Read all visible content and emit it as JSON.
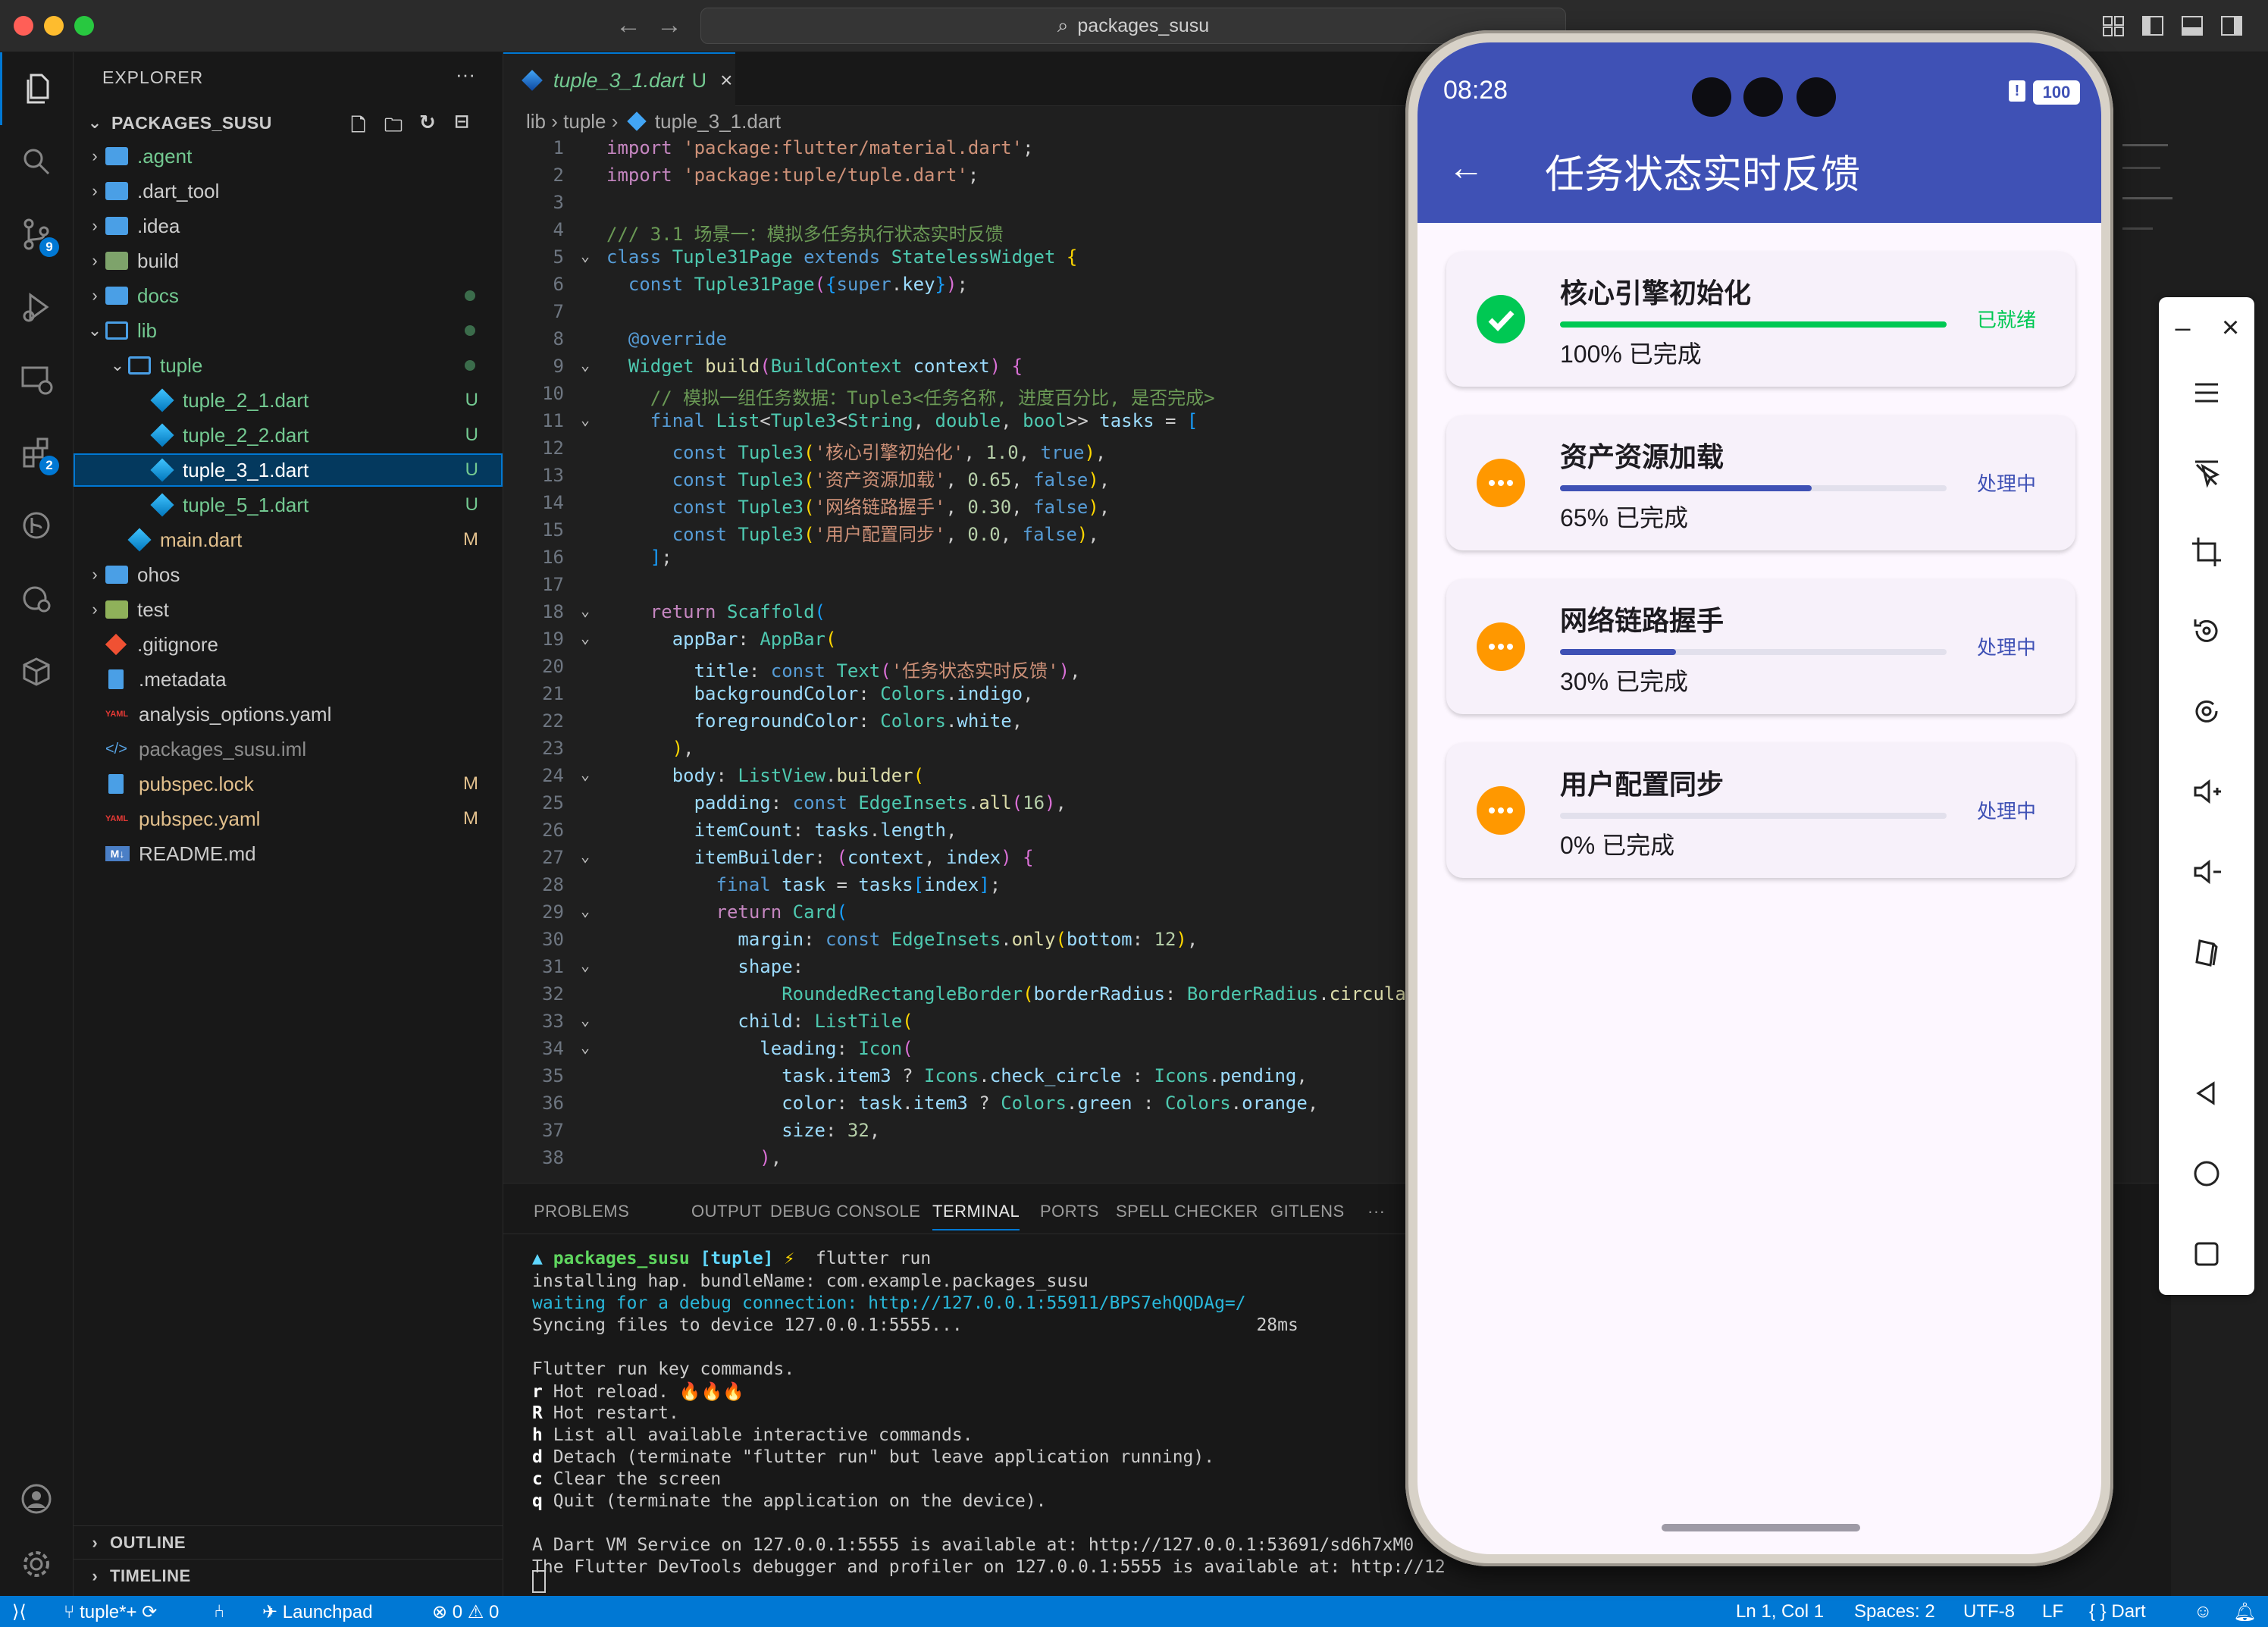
{
  "titlebar": {
    "search": "packages_susu"
  },
  "activity": {
    "scm_badge": "9",
    "extensions_badge": "2"
  },
  "explorer": {
    "title": "EXPLORER",
    "root": "PACKAGES_SUSU",
    "items": [
      {
        "label": ".agent",
        "tag": ""
      },
      {
        "label": ".dart_tool",
        "tag": ""
      },
      {
        "label": ".idea",
        "tag": ""
      },
      {
        "label": "build",
        "tag": ""
      },
      {
        "label": "docs",
        "tag": ""
      },
      {
        "label": "lib",
        "tag": ""
      },
      {
        "label": "tuple",
        "tag": ""
      },
      {
        "label": "tuple_2_1.dart",
        "tag": "U"
      },
      {
        "label": "tuple_2_2.dart",
        "tag": "U"
      },
      {
        "label": "tuple_3_1.dart",
        "tag": "U"
      },
      {
        "label": "tuple_5_1.dart",
        "tag": "U"
      },
      {
        "label": "main.dart",
        "tag": "M"
      },
      {
        "label": "ohos",
        "tag": ""
      },
      {
        "label": "test",
        "tag": ""
      },
      {
        "label": ".gitignore",
        "tag": ""
      },
      {
        "label": ".metadata",
        "tag": ""
      },
      {
        "label": "analysis_options.yaml",
        "tag": ""
      },
      {
        "label": "packages_susu.iml",
        "tag": ""
      },
      {
        "label": "pubspec.lock",
        "tag": "M"
      },
      {
        "label": "pubspec.yaml",
        "tag": "M"
      },
      {
        "label": "README.md",
        "tag": ""
      }
    ],
    "outline": "OUTLINE",
    "timeline": "TIMELINE"
  },
  "editor": {
    "tab": {
      "label": "tuple_3_1.dart",
      "status": "U"
    },
    "breadcrumb": [
      "lib",
      "tuple",
      "tuple_3_1.dart"
    ]
  },
  "panel": {
    "tabs": [
      "PROBLEMS",
      "OUTPUT",
      "DEBUG CONSOLE",
      "TERMINAL",
      "PORTS",
      "SPELL CHECKER",
      "GITLENS"
    ],
    "prompt_dir": "packages_susu",
    "prompt_branch": "[tuple]",
    "prompt_cmd": "flutter run",
    "lines": [
      "installing hap. bundleName: com.example.packages_susu",
      "waiting for a debug connection: http://127.0.0.1:55911/BPS7ehQQDAg=/",
      "Syncing files to device 127.0.0.1:5555...                            28ms",
      "",
      "Flutter run key commands.",
      "r Hot reload. 🔥🔥🔥",
      "R Hot restart.",
      "h List all available interactive commands.",
      "d Detach (terminate \"flutter run\" but leave application running).",
      "c Clear the screen",
      "q Quit (terminate the application on the device).",
      "",
      "A Dart VM Service on 127.0.0.1:5555 is available at: http://127.0.0.1:53691/sd6h7xM0",
      "The Flutter DevTools debugger and profiler on 127.0.0.1:5555 is available at: http://12"
    ]
  },
  "statusbar": {
    "branch": "tuple*+",
    "launchpad": "Launchpad",
    "errors": "0",
    "warnings": "0",
    "position": "Ln 1, Col 1",
    "spaces": "Spaces: 2",
    "encoding": "UTF-8",
    "eol": "LF",
    "language": "{ } Dart"
  },
  "phone": {
    "time": "08:28",
    "battery": "100",
    "appbar_title": "任务状态实时反馈",
    "tasks": [
      {
        "title": "核心引擎初始化",
        "progress": 1.0,
        "done": true,
        "subtitle": "100% 已完成",
        "status": "已就绪"
      },
      {
        "title": "资产资源加载",
        "progress": 0.65,
        "done": false,
        "subtitle": "65% 已完成",
        "status": "处理中"
      },
      {
        "title": "网络链路握手",
        "progress": 0.3,
        "done": false,
        "subtitle": "30% 已完成",
        "status": "处理中"
      },
      {
        "title": "用户配置同步",
        "progress": 0.0,
        "done": false,
        "subtitle": "0% 已完成",
        "status": "处理中"
      }
    ],
    "colors": {
      "indigo": "#3f51b5",
      "green": "#00c853",
      "orange": "#ff9800"
    }
  }
}
